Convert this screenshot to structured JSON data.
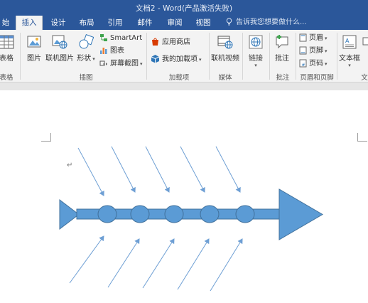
{
  "window": {
    "title": "文档2 - Word(产品激活失败)"
  },
  "tabs": [
    {
      "label": "始"
    },
    {
      "label": "插入"
    },
    {
      "label": "设计"
    },
    {
      "label": "布局"
    },
    {
      "label": "引用"
    },
    {
      "label": "邮件"
    },
    {
      "label": "审阅"
    },
    {
      "label": "视图"
    }
  ],
  "tell_me": "告诉我您想要做什么...",
  "ribbon": {
    "table": {
      "label": "表格",
      "group": "表格"
    },
    "illustrations": {
      "picture": "图片",
      "online_picture": "联机图片",
      "shapes": "形状",
      "smartart": "SmartArt",
      "chart": "图表",
      "screenshot": "屏幕截图",
      "group": "插图"
    },
    "addins": {
      "store": "应用商店",
      "my_addins": "我的加载项",
      "group": "加载项"
    },
    "media": {
      "online_video": "联机视频",
      "group": "媒体"
    },
    "links": {
      "link": "链接"
    },
    "comments": {
      "comment": "批注",
      "group": "批注"
    },
    "header_footer": {
      "header": "页眉",
      "footer": "页脚",
      "page_number": "页码",
      "group": "页眉和页脚"
    },
    "text": {
      "textbox": "文本框",
      "group": "文"
    }
  },
  "document": {
    "paragraph_mark": "↵"
  },
  "colors": {
    "title_bar": "#2b579a",
    "ribbon_bg": "#f3f3f3",
    "shape_fill": "#5b9bd5",
    "shape_stroke": "#41719c",
    "arrow_line": "#6e9fd4"
  }
}
